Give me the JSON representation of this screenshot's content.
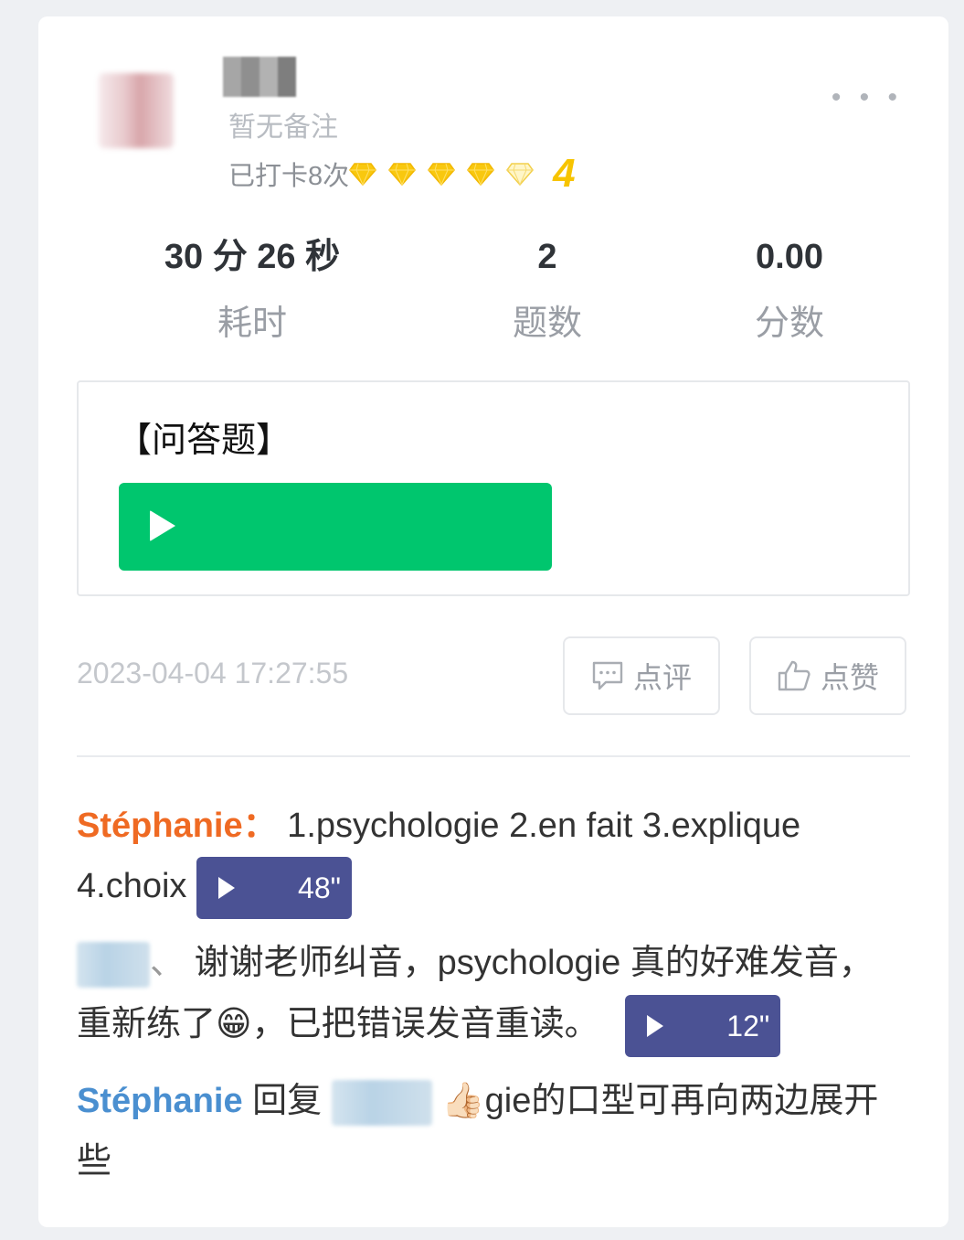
{
  "user": {
    "remark": "暂无备注",
    "checkin_text": "已打卡8次",
    "level": "4",
    "diamonds": [
      {
        "filled": true
      },
      {
        "filled": true
      },
      {
        "filled": true
      },
      {
        "filled": true
      },
      {
        "filled": false
      }
    ]
  },
  "more_label": "• • •",
  "stats": [
    {
      "value": "30 分 26 秒",
      "label": "耗时"
    },
    {
      "value": "2",
      "label": "题数"
    },
    {
      "value": "0.00",
      "label": "分数"
    }
  ],
  "question": {
    "title": "【问答题】"
  },
  "post": {
    "timestamp": "2023-04-04 17:27:55",
    "comment_button": "点评",
    "like_button": "点赞"
  },
  "comments": [
    {
      "author": "Stéphanie",
      "separator": "：",
      "text": " 1.psychologie 2.en fait 3.explique 4.choix",
      "voice_duration": "48\""
    },
    {
      "separator": "、",
      "text": " 谢谢老师纠音，psychologie 真的好难发音，重新练了",
      "emoji": "😁",
      "text2": "，已把错误发音重读。",
      "voice_duration": "12\""
    },
    {
      "author": "Stéphanie",
      "reply_word": " 回复",
      "emoji": "👍🏻",
      "text": "gie的口型可再向两边展开些"
    }
  ],
  "colors": {
    "accent_green": "#00c66e",
    "voice_bubble": "#4b5294",
    "author_orange": "#ef6a23",
    "author_blue": "#4a8fd0",
    "level_yellow": "#f7c400"
  }
}
